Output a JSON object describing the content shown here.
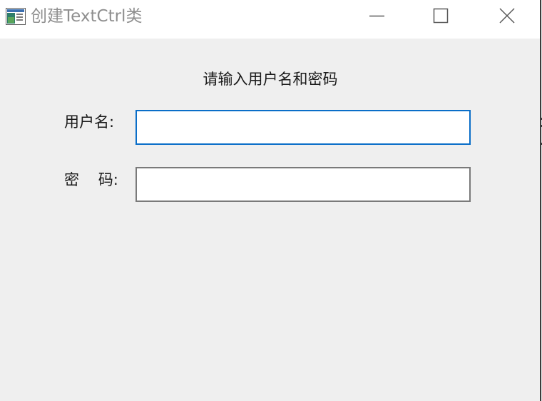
{
  "window": {
    "title": "创建TextCtrl类",
    "controls": {
      "minimize_icon": "minimize-icon",
      "maximize_icon": "maximize-icon",
      "close_icon": "close-icon"
    },
    "icon": "app-window-icon"
  },
  "form": {
    "prompt": "请输入用户名和密码",
    "username": {
      "label": "用户名:",
      "value": "",
      "placeholder": ""
    },
    "password": {
      "label": "密    码:",
      "value": "",
      "placeholder": ""
    }
  },
  "colors": {
    "titlebar_bg": "#ffffff",
    "client_bg": "#efefef",
    "focused_border": "#0a6ec8",
    "normal_border": "#7a7a7a",
    "title_text": "#8f8f8f"
  }
}
